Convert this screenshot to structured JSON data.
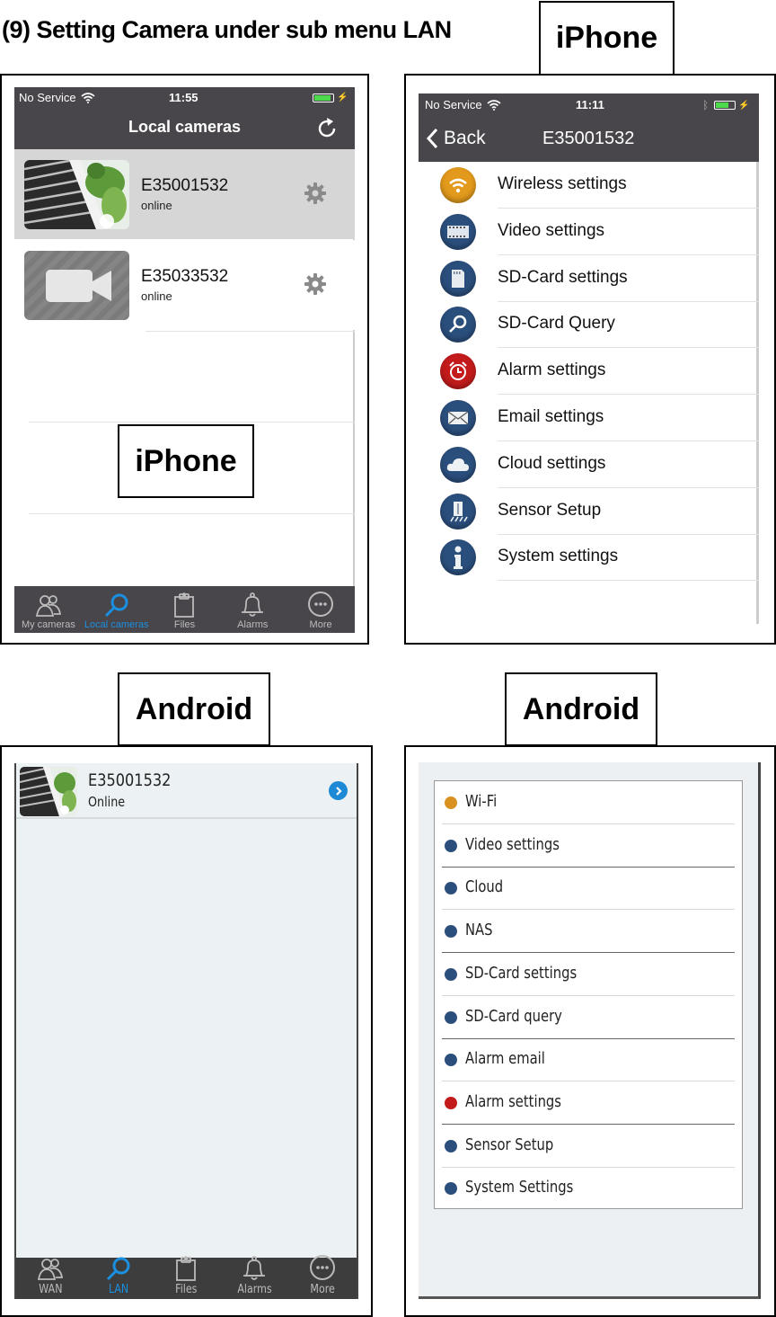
{
  "heading": "(9) Setting Camera under sub menu LAN",
  "labels": {
    "iphone_top": "iPhone",
    "iphone_overlay": "iPhone",
    "android_left": "Android",
    "android_right": "Android"
  },
  "iphone_local": {
    "status": {
      "carrier": "No Service",
      "time": "11:55",
      "battery_percent": 90
    },
    "title": "Local cameras",
    "cameras": [
      {
        "name": "E35001532",
        "status": "online",
        "thumbnail": "camera-snapshot",
        "selected": true
      },
      {
        "name": "E35033532",
        "status": "online",
        "thumbnail": "video-camera-placeholder",
        "selected": false
      }
    ],
    "tabs": [
      {
        "label": "My cameras",
        "icon": "people-icon",
        "active": false
      },
      {
        "label": "Local cameras",
        "icon": "search-icon",
        "active": true
      },
      {
        "label": "Files",
        "icon": "clipboard-icon",
        "active": false
      },
      {
        "label": "Alarms",
        "icon": "bell-icon",
        "active": false
      },
      {
        "label": "More",
        "icon": "more-icon",
        "active": false
      }
    ]
  },
  "iphone_settings": {
    "status": {
      "carrier": "No Service",
      "time": "11:11",
      "battery_percent": 70
    },
    "back_label": "Back",
    "title": "E35001532",
    "items": [
      {
        "label": "Wireless settings",
        "icon": "wifi-icon",
        "color": "#e39a1c"
      },
      {
        "label": "Video settings",
        "icon": "film-icon",
        "color": "#2b4f7d"
      },
      {
        "label": "SD-Card settings",
        "icon": "sd-card-icon",
        "color": "#2b4f7d"
      },
      {
        "label": "SD-Card Query",
        "icon": "magnifier-icon",
        "color": "#2b4f7d"
      },
      {
        "label": "Alarm settings",
        "icon": "alarm-clock-icon",
        "color": "#c31b1b"
      },
      {
        "label": "Email settings",
        "icon": "envelope-icon",
        "color": "#2b4f7d"
      },
      {
        "label": "Cloud settings",
        "icon": "cloud-icon",
        "color": "#2b4f7d"
      },
      {
        "label": "Sensor Setup",
        "icon": "sensor-icon",
        "color": "#2b4f7d"
      },
      {
        "label": "System settings",
        "icon": "info-icon",
        "color": "#2b4f7d"
      }
    ]
  },
  "android_local": {
    "camera": {
      "name": "E35001532",
      "status": "Online"
    },
    "tabs": [
      {
        "label": "WAN",
        "icon": "people-icon",
        "active": false
      },
      {
        "label": "LAN",
        "icon": "search-icon",
        "active": true
      },
      {
        "label": "Files",
        "icon": "clipboard-icon",
        "active": false
      },
      {
        "label": "Alarms",
        "icon": "bell-icon",
        "active": false
      },
      {
        "label": "More",
        "icon": "more-icon",
        "active": false
      }
    ]
  },
  "android_settings": {
    "items": [
      {
        "label": "Wi-Fi",
        "icon": "wifi-icon",
        "color": "#d9921f"
      },
      {
        "label": "Video settings",
        "icon": "film-icon",
        "color": "#2b4f7d"
      },
      {
        "label": "Cloud",
        "icon": "cloud-icon",
        "color": "#2b4f7d"
      },
      {
        "label": "NAS",
        "icon": "info-icon",
        "color": "#2b4f7d"
      },
      {
        "label": "SD-Card settings",
        "icon": "sd-card-icon",
        "color": "#2b4f7d"
      },
      {
        "label": "SD-Card query",
        "icon": "magnifier-icon",
        "color": "#2b4f7d"
      },
      {
        "label": "Alarm email",
        "icon": "envelope-icon",
        "color": "#2b4f7d"
      },
      {
        "label": "Alarm settings",
        "icon": "alarm-clock-icon",
        "color": "#c31b1b"
      },
      {
        "label": "Sensor Setup",
        "icon": "sensor-icon",
        "color": "#2b4f7d"
      },
      {
        "label": "System Settings",
        "icon": "info-icon",
        "color": "#2b4f7d"
      }
    ]
  }
}
